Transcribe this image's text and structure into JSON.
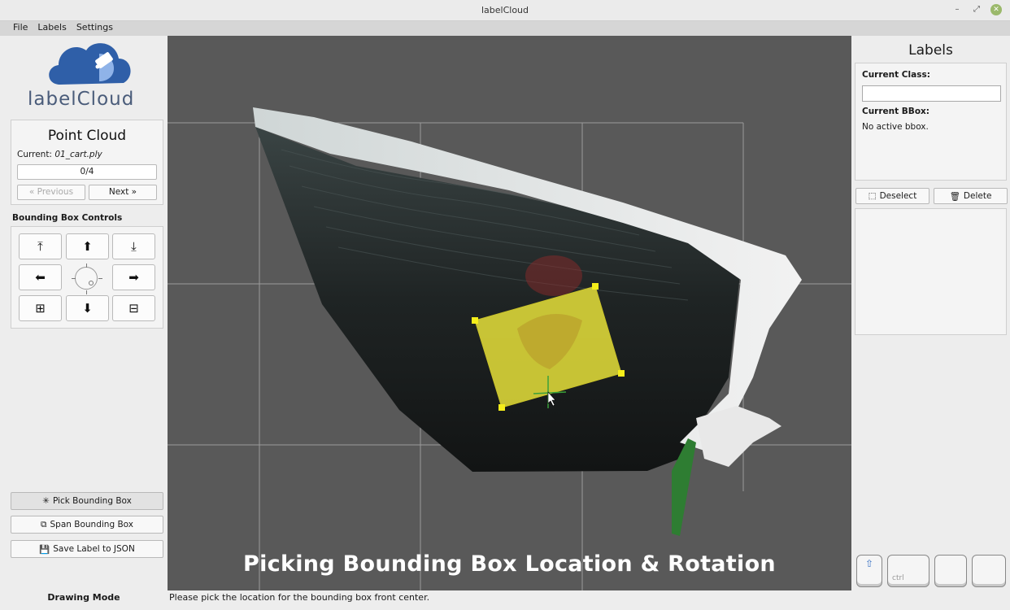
{
  "window": {
    "title": "labelCloud"
  },
  "menu": [
    "File",
    "Labels",
    "Settings"
  ],
  "logo": {
    "text": "labelCloud"
  },
  "point_cloud": {
    "title": "Point Cloud",
    "current_label": "Current:",
    "current_file": "01_cart.ply",
    "progress": "0/4",
    "previous": "« Previous",
    "next": "Next »"
  },
  "bbox_controls": {
    "title": "Bounding Box Controls",
    "buttons": [
      {
        "name": "move-up-icon",
        "glyph": "⭱"
      },
      {
        "name": "arrow-up-icon",
        "glyph": "🡅"
      },
      {
        "name": "move-down-icon",
        "glyph": "⭳"
      },
      {
        "name": "arrow-left-icon",
        "glyph": "🡄"
      },
      {
        "name": "arrow-right-icon",
        "glyph": "🡆"
      },
      {
        "name": "increase-icon",
        "glyph": "⊞"
      },
      {
        "name": "arrow-down-icon",
        "glyph": "🡇"
      },
      {
        "name": "decrease-icon",
        "glyph": "⊟"
      }
    ]
  },
  "modes": {
    "pick": "Pick Bounding Box",
    "span": "Span Bounding Box",
    "save": "Save Label to JSON",
    "label": "Drawing Mode"
  },
  "viewport": {
    "caption": "Picking Bounding Box Location & Rotation"
  },
  "status": {
    "message": "Please pick the location for the bounding box front center."
  },
  "labels_panel": {
    "title": "Labels",
    "current_class_label": "Current Class:",
    "current_class_value": "",
    "current_bbox_label": "Current BBox:",
    "current_bbox_value": "No active bbox.",
    "deselect": "Deselect",
    "delete": "Delete"
  },
  "keys": {
    "ctrl": "ctrl"
  },
  "colors": {
    "bbox_fill": "#e6e03a",
    "bbox_handle": "#f5ee1a",
    "viewport_bg": "#595959",
    "logo_blue": "#2f5fa8"
  }
}
